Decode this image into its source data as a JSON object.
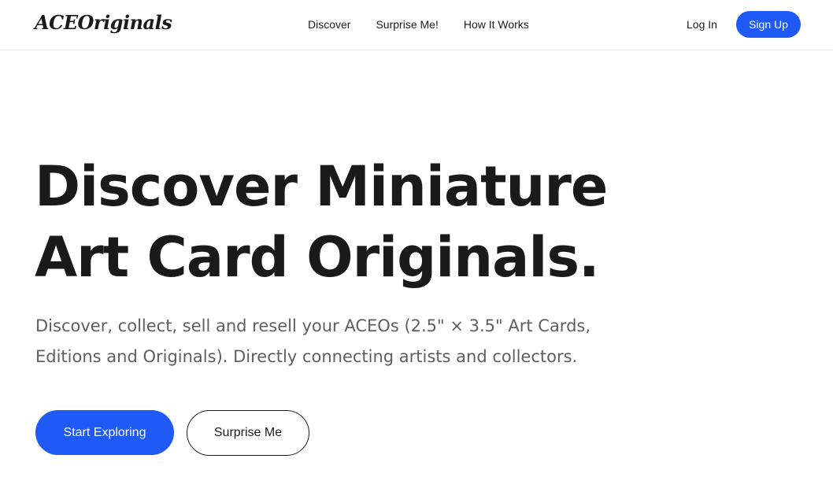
{
  "header": {
    "logo": "ACEOriginals",
    "nav": [
      {
        "label": "Discover"
      },
      {
        "label": "Surprise Me!"
      },
      {
        "label": "How It Works"
      }
    ],
    "login_label": "Log In",
    "signup_label": "Sign Up"
  },
  "hero": {
    "title_line1": "Discover Miniature",
    "title_line2": "Art Card Originals.",
    "subtitle_line1": "Discover, collect, sell and resell your ACEOs (2.5\" × 3.5\" Art Cards,",
    "subtitle_line2": "Editions and Originals). Directly connecting artists and collectors.",
    "primary_cta": "Start Exploring",
    "secondary_cta": "Surprise Me"
  },
  "colors": {
    "accent": "#1f5af6",
    "text": "#1a1a1a",
    "muted": "#5f5f5f",
    "border": "#e6e6e6"
  }
}
